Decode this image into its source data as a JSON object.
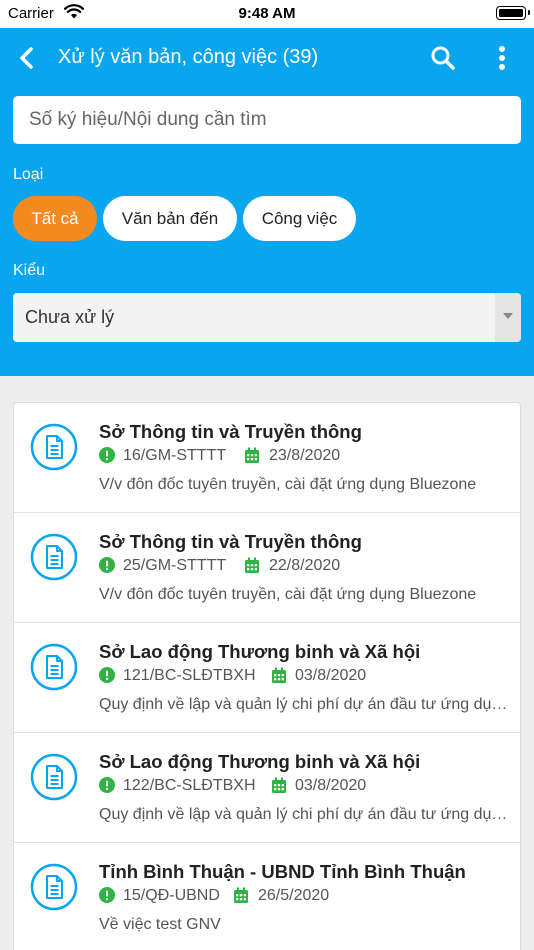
{
  "status_bar": {
    "carrier": "Carrier",
    "time": "9:48 AM"
  },
  "nav": {
    "title": "Xử lý văn bản, công việc (39)"
  },
  "search": {
    "placeholder": "Số ký hiệu/Nội dung cần tìm"
  },
  "filters": {
    "type_label": "Loại",
    "chips": [
      {
        "label": "Tất cả",
        "active": true
      },
      {
        "label": "Văn bản đến",
        "active": false
      },
      {
        "label": "Công việc",
        "active": false
      }
    ],
    "kind_label": "Kiểu",
    "kind_value": "Chưa xử lý"
  },
  "colors": {
    "header": "#0aa5ef",
    "active_chip": "#f58a20",
    "alert": "#2fb344",
    "calendar": "#2fb344"
  },
  "items": [
    {
      "title": "Sở Thông tin và Truyền thông",
      "number": "16/GM-STTTT",
      "date": "23/8/2020",
      "desc": "V/v đôn đốc tuyên truyền, cài đặt ứng dụng Bluezone"
    },
    {
      "title": "Sở Thông tin và Truyền thông",
      "number": "25/GM-STTTT",
      "date": "22/8/2020",
      "desc": "V/v đôn đốc tuyên truyền, cài đặt ứng dụng Bluezone"
    },
    {
      "title": "Sở Lao động Thương binh và Xã hội",
      "number": "121/BC-SLĐTBXH",
      "date": "03/8/2020",
      "desc": "Quy định về lập và quản lý chi phí dự án đầu tư ứng dụng"
    },
    {
      "title": "Sở Lao động Thương binh và Xã hội",
      "number": "122/BC-SLĐTBXH",
      "date": "03/8/2020",
      "desc": "Quy định về lập và quản lý chi phí dự án đầu tư ứng dụng"
    },
    {
      "title": "Tỉnh Bình Thuận - UBND Tỉnh Bình Thuận",
      "number": "15/QĐ-UBND",
      "date": "26/5/2020",
      "desc": "Về việc test GNV"
    }
  ]
}
